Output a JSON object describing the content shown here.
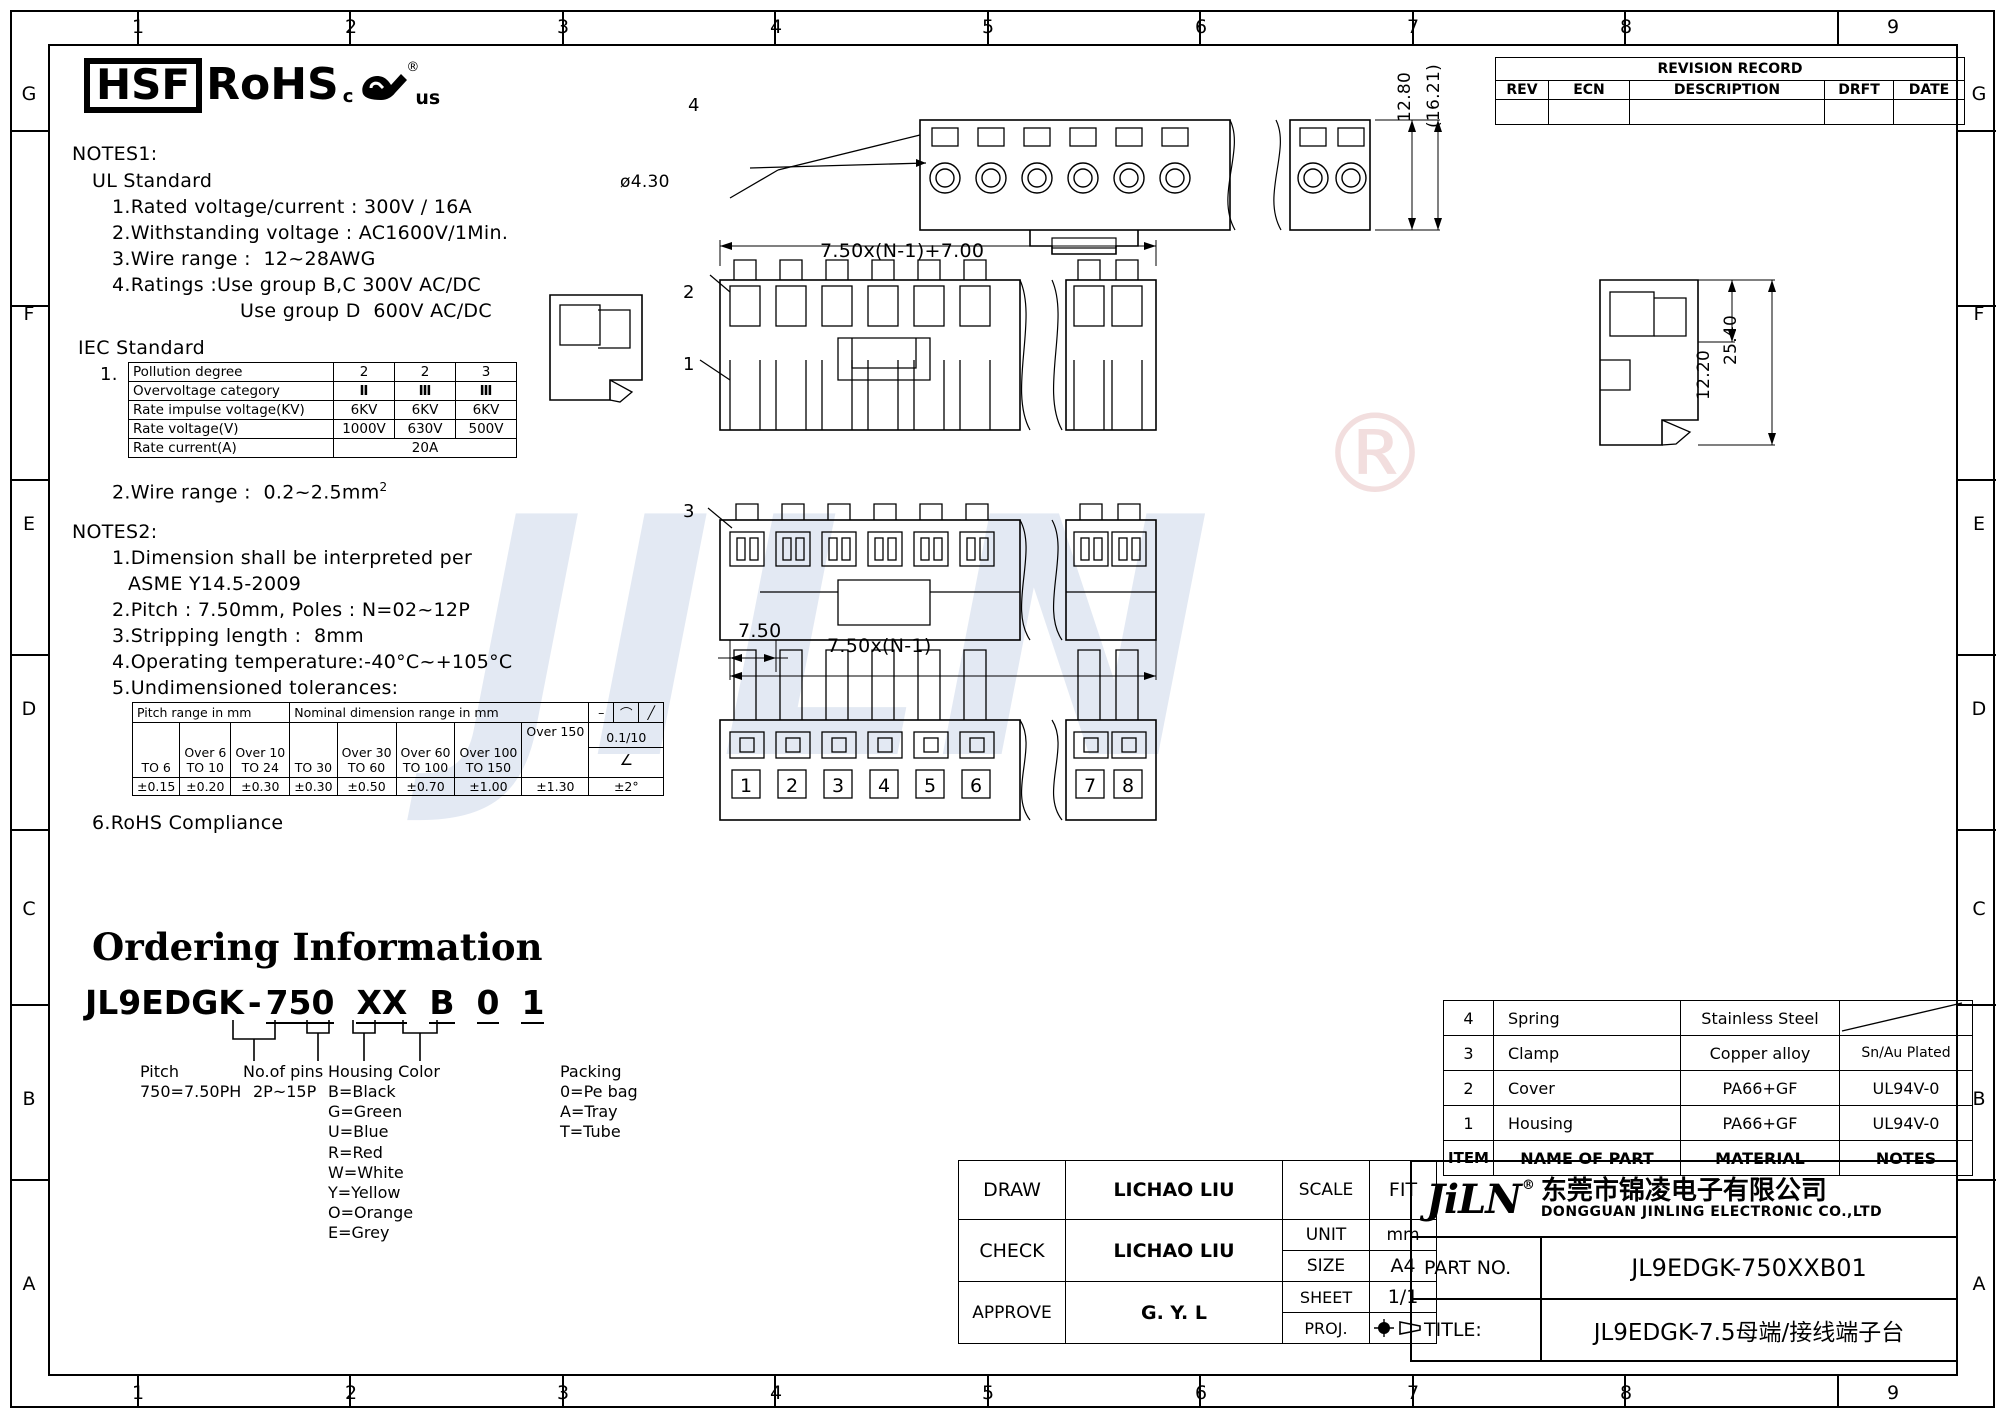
{
  "sheet": {
    "zones_top": [
      "1",
      "2",
      "3",
      "4",
      "5",
      "6",
      "7",
      "8",
      "9"
    ],
    "zones_bottom": [
      "1",
      "2",
      "3",
      "4",
      "5",
      "6",
      "7",
      "8",
      "9"
    ],
    "zones_left": [
      "G",
      "F",
      "E",
      "D",
      "C",
      "B",
      "A"
    ],
    "zones_right": [
      "G",
      "F",
      "E",
      "D",
      "C",
      "B",
      "A"
    ]
  },
  "compliance": {
    "hsf": "HSF",
    "rohs": "RoHS",
    "ul_c": "c",
    "ul_us": "us",
    "ul_reg": "®"
  },
  "notes1": {
    "heading": "NOTES1:",
    "ul_heading": "UL Standard",
    "items": [
      "1.Rated voltage/current : 300V / 16A",
      "2.Withstanding voltage : AC1600V/1Min.",
      "3.Wire range :  12~28AWG",
      "4.Ratings :Use group B,C 300V AC/DC",
      "Use group D  600V AC/DC"
    ],
    "iec_heading": "IEC Standard",
    "iec_index": "1.",
    "iec_table": {
      "rows": [
        {
          "label": "Pollution degree",
          "values": [
            "2",
            "2",
            "3"
          ]
        },
        {
          "label": "Overvoltage category",
          "values": [
            "Ⅱ",
            "Ⅲ",
            "Ⅲ"
          ]
        },
        {
          "label": "Rate impulse voltage(KV)",
          "values": [
            "6KV",
            "6KV",
            "6KV"
          ]
        },
        {
          "label": "Rate voltage(V)",
          "values": [
            "1000V",
            "630V",
            "500V"
          ]
        },
        {
          "label": "Rate current(A)",
          "values": [
            "20A"
          ],
          "span": true
        }
      ]
    },
    "wire_range": "2.Wire range :  0.2~2.5mm",
    "wire_range_sup": "2"
  },
  "notes2": {
    "heading": "NOTES2:",
    "items": [
      "1.Dimension shall be interpreted per",
      "ASME Y14.5-2009",
      "2.Pitch : 7.50mm, Poles : N=02~12P",
      "3.Stripping length :  8mm",
      "4.Operating temperature:-40°C~+105°C",
      "5.Undimensioned tolerances:",
      "6.RoHS Compliance"
    ],
    "tol_table": {
      "header_pitch": "Pitch range in mm",
      "header_nominal": "Nominal dimension range in mm",
      "sym_dash": "–",
      "sym_arc": "⌒",
      "sym_par": "╱",
      "cols": [
        {
          "over": "",
          "to": "TO 6"
        },
        {
          "over": "Over 6",
          "to": "TO 10"
        },
        {
          "over": "Over 10",
          "to": "TO 24"
        },
        {
          "over": "",
          "to": "TO 30"
        },
        {
          "over": "Over 30",
          "to": "TO 60"
        },
        {
          "over": "Over 60",
          "to": "TO 100"
        },
        {
          "over": "Over 100",
          "to": "TO 150"
        },
        {
          "over": "Over 150",
          "to": ""
        }
      ],
      "tolerances": [
        "±0.15",
        "±0.20",
        "±0.30",
        "±0.30",
        "±0.50",
        "±0.70",
        "±1.00",
        "±1.30"
      ],
      "angular_ratio": "0.1/10",
      "angular_sym": "∠",
      "angular_tol": "±2°"
    }
  },
  "ordering": {
    "title": "Ordering Information",
    "code_parts": [
      "JL9EDGK",
      "-",
      "750",
      "XX",
      "B",
      "0",
      "1"
    ],
    "legend": [
      {
        "title": "Pitch",
        "lines": [
          "750=7.50PH"
        ]
      },
      {
        "title": "No.of pins",
        "lines": [
          "2P~15P"
        ]
      },
      {
        "title": "Housing Color",
        "lines": [
          "B=Black",
          "G=Green",
          "U=Blue",
          "R=Red",
          "W=White",
          "Y=Yellow",
          "O=Orange",
          "E=Grey"
        ]
      },
      {
        "title": "Packing",
        "lines": [
          "0=Pe bag",
          "A=Tray",
          "T=Tube"
        ]
      }
    ]
  },
  "drawing": {
    "callouts": [
      "1",
      "2",
      "3",
      "4"
    ],
    "dims": {
      "hole_dia": "ø4.30",
      "height_1280": "12.80",
      "height_1621": "(16.21)",
      "length_formula": "7.50x(N-1)+7.00",
      "pitch_formula": "7.50x(N-1)",
      "pitch_single": "7.50",
      "depth_2540": "25.40",
      "depth_1220": "12.20"
    },
    "pin_numbers": [
      "1",
      "2",
      "3",
      "4",
      "5",
      "6",
      "7",
      "8"
    ]
  },
  "revision": {
    "title": "REVISION RECORD",
    "headers": [
      "REV",
      "ECN",
      "DESCRIPTION",
      "DRFT",
      "DATE"
    ],
    "rows": [
      [
        "",
        "",
        "",
        "",
        ""
      ]
    ]
  },
  "bom": {
    "headers": [
      "ITEM",
      "NAME OF PART",
      "MATERIAL",
      "NOTES"
    ],
    "rows": [
      {
        "item": "4",
        "name": "Spring",
        "material": "Stainless Steel",
        "notes": ""
      },
      {
        "item": "3",
        "name": "Clamp",
        "material": "Copper alloy",
        "notes": "Sn/Au Plated"
      },
      {
        "item": "2",
        "name": "Cover",
        "material": "PA66+GF",
        "notes": "UL94V-0"
      },
      {
        "item": "1",
        "name": "Housing",
        "material": "PA66+GF",
        "notes": "UL94V-0"
      }
    ]
  },
  "titleblock": {
    "draw_label": "DRAW",
    "draw_value": "LICHAO LIU",
    "check_label": "CHECK",
    "check_value": "LICHAO LIU",
    "approve_label": "APPROVE",
    "approve_value": "G. Y. L",
    "scale_label": "SCALE",
    "scale_value": "FIT",
    "unit_label": "UNIT",
    "unit_value": "mm",
    "size_label": "SIZE",
    "size_value": "A4",
    "sheet_label": "SHEET",
    "sheet_value": "1/1",
    "proj_label": "PROJ.",
    "company_logo": "JiLN",
    "company_reg": "®",
    "company_cn": "东莞市锦凌电子有限公司",
    "company_en": "DONGGUAN JINLING ELECTRONIC CO.,LTD",
    "partno_label": "PART NO.",
    "partno_value": "JL9EDGK-750XXB01",
    "title_label": "TITLE:",
    "title_value": "JL9EDGK-7.5母端/接线端子台"
  },
  "watermark": {
    "text": "JILN",
    "reg": "®"
  }
}
